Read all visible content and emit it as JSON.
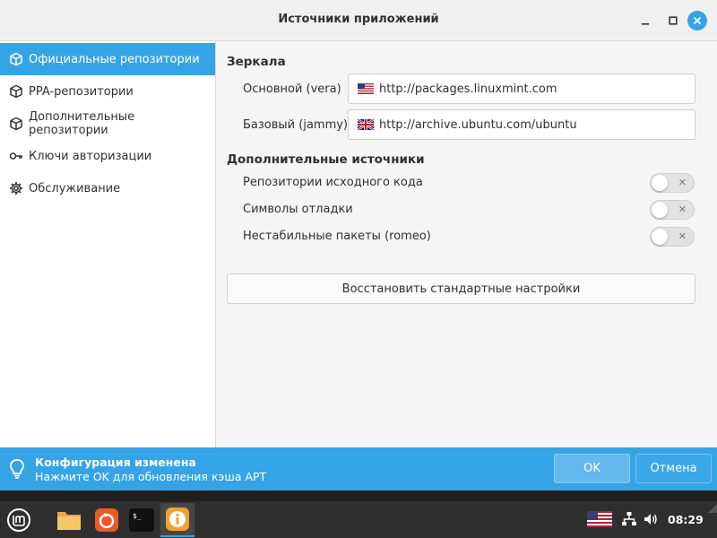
{
  "window": {
    "title": "Источники приложений"
  },
  "sidebar": {
    "items": [
      {
        "label": "Официальные репозитории",
        "icon": "package-icon",
        "active": true
      },
      {
        "label": "PPA-репозитории",
        "icon": "package-icon",
        "active": false
      },
      {
        "label": "Дополнительные репозитории",
        "icon": "package-icon",
        "active": false
      },
      {
        "label": "Ключи авторизации",
        "icon": "key-icon",
        "active": false
      },
      {
        "label": "Обслуживание",
        "icon": "gear-icon",
        "active": false
      }
    ]
  },
  "mirrors": {
    "title": "Зеркала",
    "main": {
      "label": "Основной (vera)",
      "url": "http://packages.linuxmint.com",
      "flag": "us-flag-icon"
    },
    "base": {
      "label": "Базовый (jammy)",
      "url": "http://archive.ubuntu.com/ubuntu",
      "flag": "uk-flag-icon"
    }
  },
  "extra": {
    "title": "Дополнительные источники",
    "options": [
      {
        "label": "Репозитории исходного кода",
        "enabled": false
      },
      {
        "label": "Символы отладки",
        "enabled": false
      },
      {
        "label": "Нестабильные пакеты (romeo)",
        "enabled": false
      }
    ],
    "toggle_off_symbol": "✕"
  },
  "restore_button": "Восстановить стандартные настройки",
  "infobar": {
    "title": "Конфигурация изменена",
    "subtitle": "Нажмите OK для обновления кэша APT",
    "ok_label": "OK",
    "cancel_label": "Отмена"
  },
  "taskbar": {
    "clock": "08:29",
    "apps": [
      "mint-menu-icon",
      "files-icon",
      "firefox-icon",
      "terminal-icon",
      "info-icon"
    ]
  },
  "colors": {
    "accent": "#35a4e6",
    "panel": "#2f2f2f"
  }
}
